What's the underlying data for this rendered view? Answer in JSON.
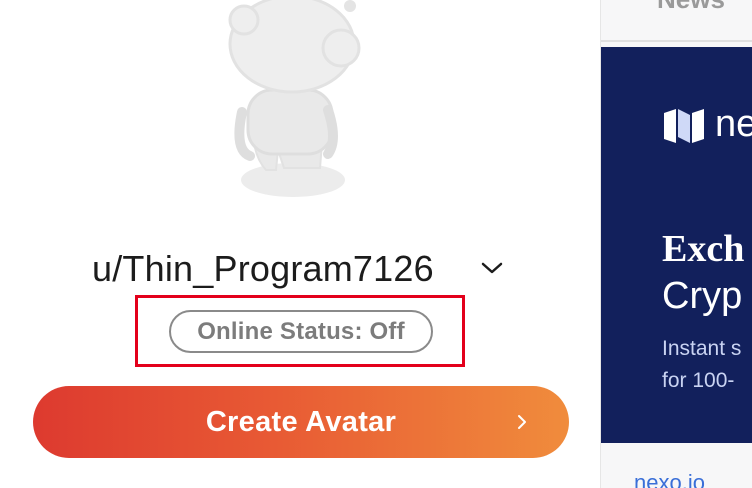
{
  "profile": {
    "username": "u/Thin_Program7126",
    "online_status": "Online Status: Off",
    "create_avatar_label": "Create Avatar"
  },
  "icons": {
    "avatar": "snoo-avatar-placeholder-icon",
    "username_menu": "chevron-down-icon",
    "create_avatar_arrow": "chevron-right-icon",
    "ad_logo": "nexo-logo-icon"
  },
  "sidebar": {
    "tab_label": "News",
    "ad": {
      "brand": "ne",
      "headline_line1": "Exch",
      "headline_line2": "Cryp",
      "body_line1": "Instant s",
      "body_line2": "for 100-",
      "link": "nexo.io"
    }
  },
  "colors": {
    "highlight_border": "#e3001b",
    "button_gradient_start": "#dd3a2f",
    "button_gradient_end": "#f08c3c",
    "ad_background": "#12205c",
    "status_pill_border": "#8a8a8a"
  }
}
